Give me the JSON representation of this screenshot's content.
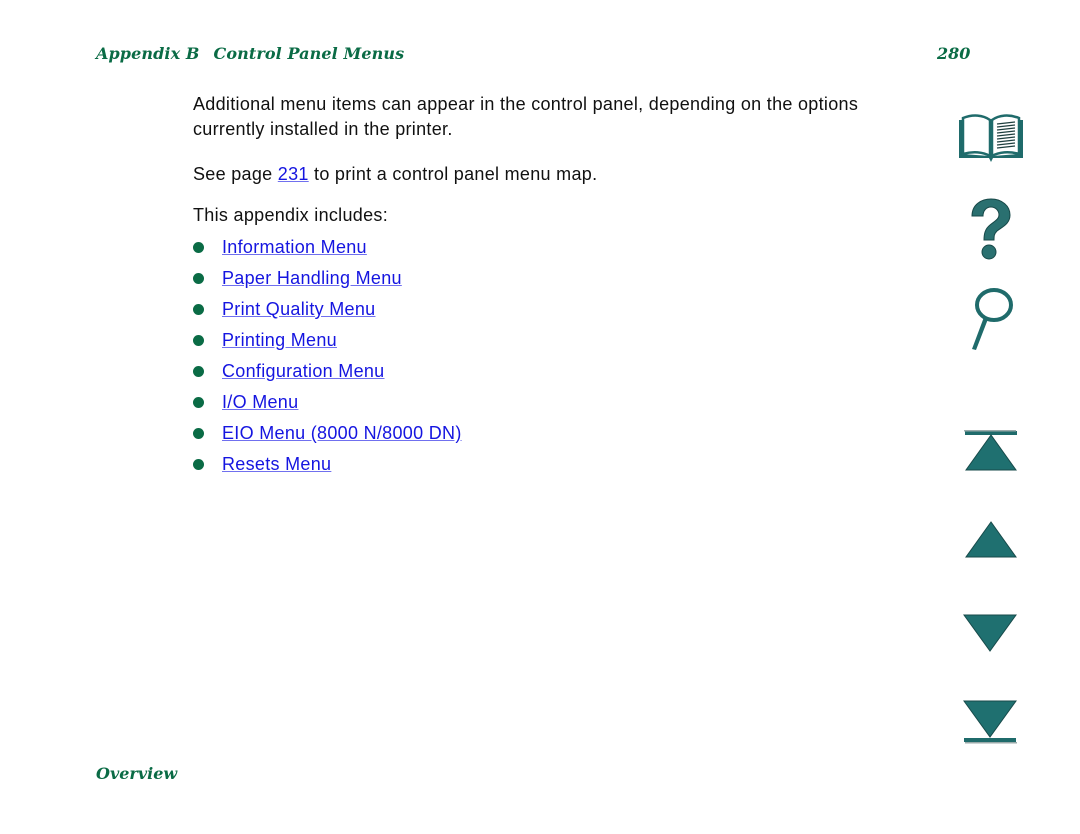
{
  "header": {
    "appendix": "Appendix B",
    "section": "Control Panel Menus",
    "page_number": "280"
  },
  "body": {
    "intro": "Additional menu items can appear in the control panel, depending on the options currently installed in the printer.",
    "see_prefix": "See page ",
    "see_link": "231",
    "see_suffix": " to print a control panel menu map.",
    "includes_label": "This appendix includes:",
    "toc": [
      {
        "label": "Information Menu"
      },
      {
        "label": "Paper Handling Menu"
      },
      {
        "label": "Print Quality Menu"
      },
      {
        "label": "Printing Menu"
      },
      {
        "label": "Configuration Menu"
      },
      {
        "label": "I/O Menu"
      },
      {
        "label": "EIO Menu (8000 N/8000 DN)"
      },
      {
        "label": "Resets Menu"
      }
    ]
  },
  "footer": {
    "section": "Overview"
  },
  "nav_icons": [
    {
      "name": "contents",
      "icon": "book-icon"
    },
    {
      "name": "help",
      "icon": "question-icon"
    },
    {
      "name": "search",
      "icon": "magnifier-icon"
    },
    {
      "name": "first-page",
      "icon": "first-page-icon"
    },
    {
      "name": "previous-page",
      "icon": "previous-page-icon"
    },
    {
      "name": "next-page",
      "icon": "next-page-icon"
    },
    {
      "name": "last-page",
      "icon": "last-page-icon"
    }
  ],
  "colors": {
    "heading": "#0a6b45",
    "link": "#1515e0",
    "icon": "#1f6b6b"
  }
}
